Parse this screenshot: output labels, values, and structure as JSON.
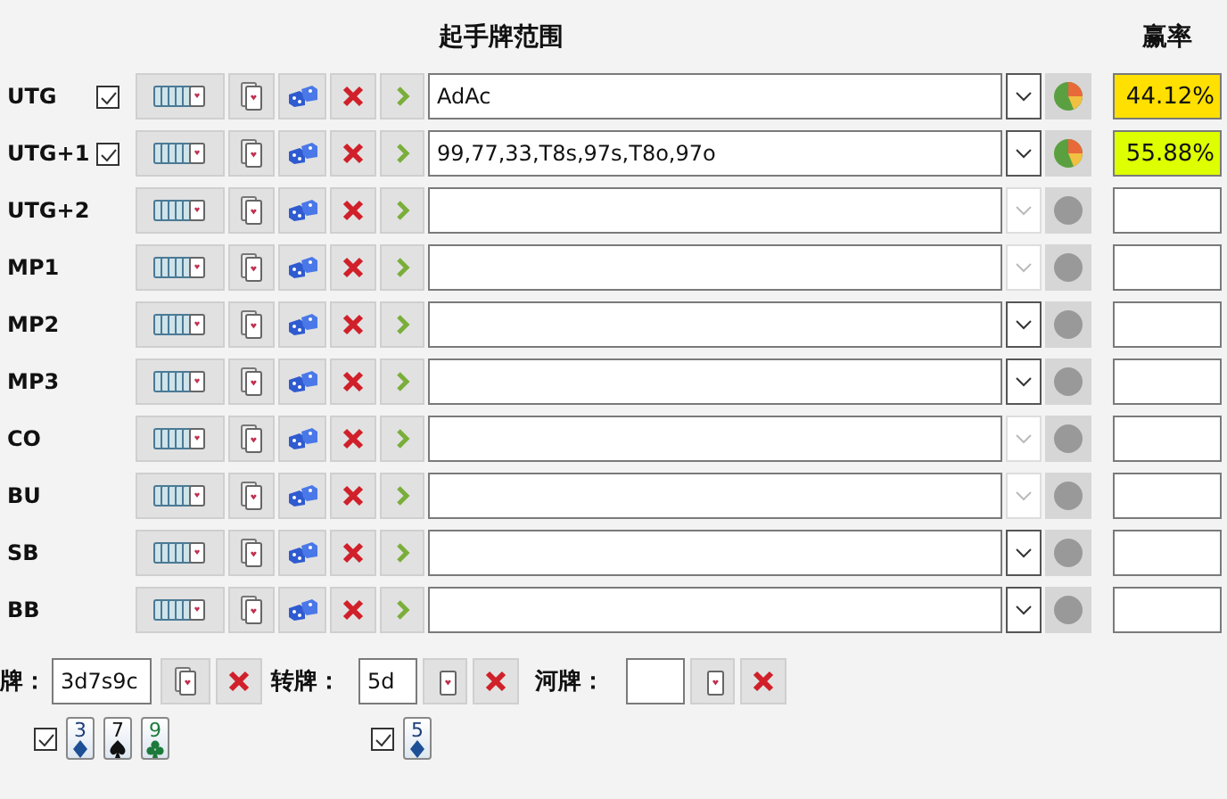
{
  "headers": {
    "range": "起手牌范围",
    "equity": "赢率"
  },
  "players": [
    {
      "position": "UTG",
      "checked": true,
      "range": "AdAc",
      "dropdown_disabled": false,
      "calculated": true,
      "equity": "44.12%",
      "color": "#ffe000"
    },
    {
      "position": "UTG+1",
      "checked": true,
      "range": "99,77,33,T8s,97s,T8o,97o",
      "dropdown_disabled": false,
      "calculated": true,
      "equity": "55.88%",
      "color": "#ddff00"
    },
    {
      "position": "UTG+2",
      "dropdown_disabled": true,
      "calculated": false
    },
    {
      "position": "MP1",
      "dropdown_disabled": true,
      "calculated": false
    },
    {
      "position": "MP2",
      "dropdown_disabled": false,
      "calculated": false
    },
    {
      "position": "MP3",
      "dropdown_disabled": false,
      "calculated": false
    },
    {
      "position": "CO",
      "dropdown_disabled": true,
      "calculated": false
    },
    {
      "position": "BU",
      "dropdown_disabled": true,
      "calculated": false
    },
    {
      "position": "SB",
      "dropdown_disabled": false,
      "calculated": false
    },
    {
      "position": "BB",
      "dropdown_disabled": false,
      "calculated": false
    }
  ],
  "board": {
    "flop_label": "牌：",
    "flop": "3d7s9c",
    "turn_label": "转牌：",
    "turn": "5d",
    "river_label": "河牌："
  },
  "flop_cards": {
    "checked": true,
    "cards": [
      {
        "rank": "3",
        "kind": "diamond"
      },
      {
        "rank": "7",
        "kind": "spade"
      },
      {
        "rank": "9",
        "kind": "club"
      }
    ]
  },
  "turn_cards": {
    "checked": true,
    "cards": [
      {
        "rank": "5",
        "kind": "diamond"
      }
    ]
  }
}
